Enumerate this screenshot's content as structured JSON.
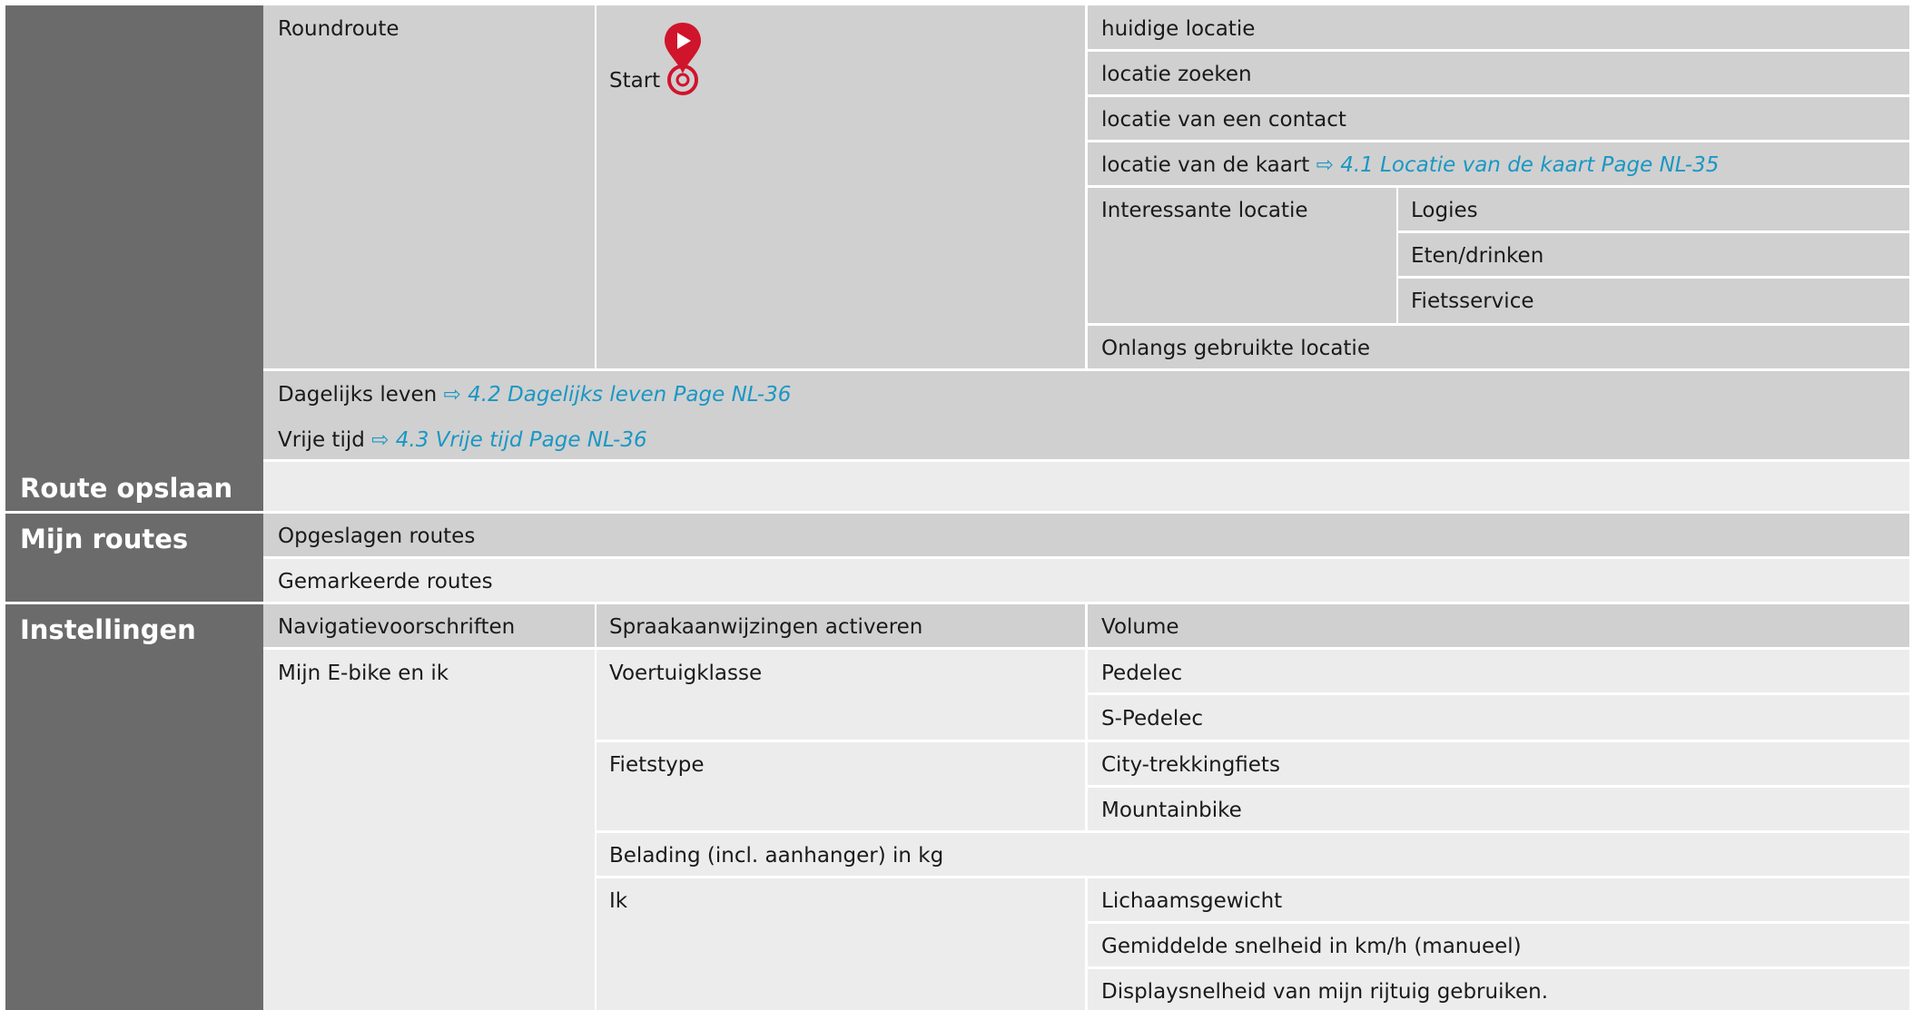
{
  "sidebar": {
    "route_opslaan": "Route opslaan",
    "mijn_routes": "Mijn routes",
    "instellingen": "Instellingen"
  },
  "roundroute": {
    "label": "Roundroute",
    "start_label": "Start",
    "start_icon": "start-pin-icon",
    "options": {
      "huidige": "huidige locatie",
      "zoeken": "locatie zoeken",
      "contact": "locatie van een contact",
      "kaart": "locatie van de kaart",
      "kaart_link": "4.1 Locatie van de kaart Page NL-35",
      "interessant": "Interessante locatie",
      "logies": "Logies",
      "eten": "Eten/drinken",
      "fietsservice": "Fietsservice",
      "onlangs": "Onlangs gebruikte locatie"
    }
  },
  "dagelijks": {
    "label": "Dagelijks leven",
    "link": "4.2 Dagelijks leven Page NL-36"
  },
  "vrije_tijd": {
    "label": "Vrije tijd",
    "link": "4.3 Vrije tijd Page NL-36"
  },
  "link_arrow": "⇨",
  "mijn_routes": {
    "opgeslagen": "Opgeslagen routes",
    "gemarkeerde": "Gemarkeerde routes"
  },
  "instellingen": {
    "navigatie": "Navigatievoorschriften",
    "spraak": "Spraakaanwijzingen activeren",
    "volume": "Volume",
    "ebike": "Mijn E-bike en ik",
    "voertuigklasse": "Voertuigklasse",
    "pedelec": "Pedelec",
    "s_pedelec": "S-Pedelec",
    "fietstype": "Fietstype",
    "city": "City-trekkingfiets",
    "mountainbike": "Mountainbike",
    "belading": "Belading (incl. aanhanger) in kg",
    "ik": "Ik",
    "lichaamsgewicht": "Lichaamsgewicht",
    "snelheid": "Gemiddelde snelheid in km/h (manueel)",
    "displaysnelheid": "Displaysnelheid van mijn rijtuig gebruiken."
  },
  "colors": {
    "sidebar": "#6b6b6b",
    "cell_medium": "#d0d0d0",
    "cell_light": "#ececec",
    "link": "#1a97c4",
    "pin": "#d0142c"
  }
}
